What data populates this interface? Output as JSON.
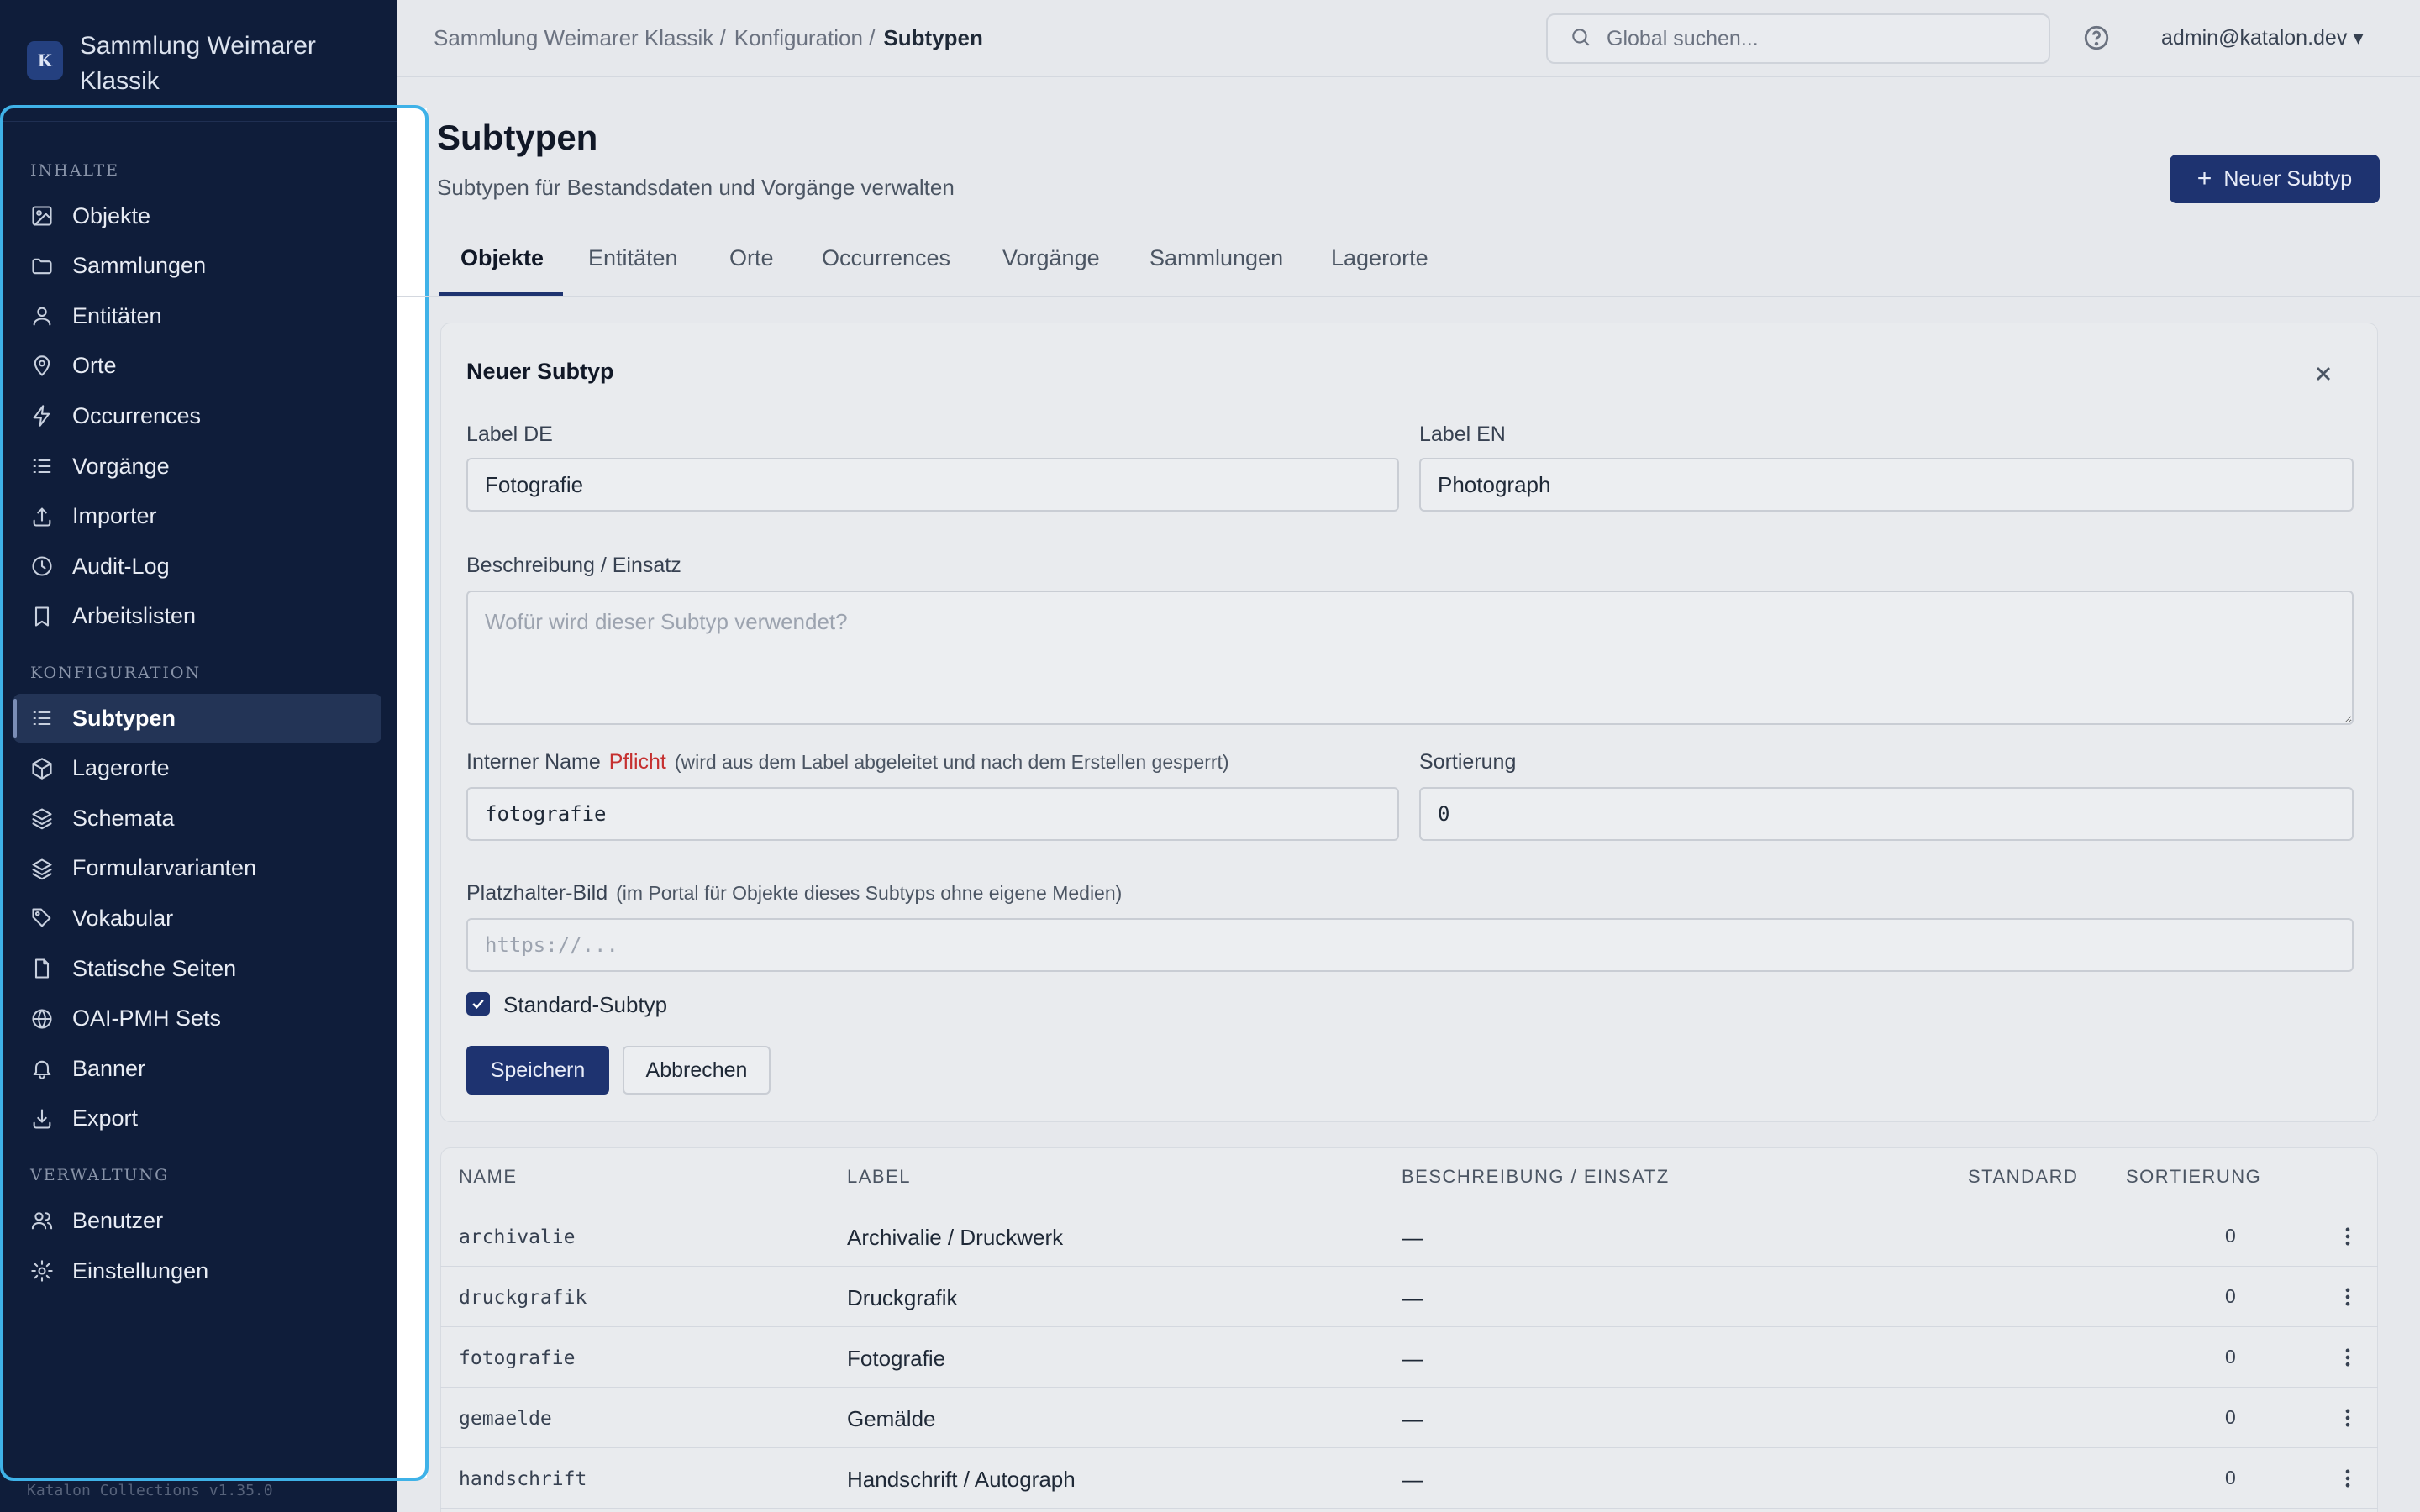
{
  "app": {
    "name": "Sammlung Weimarer Klassik",
    "logo_letter": "K",
    "version": "Katalon Collections v1.35.0"
  },
  "sidebar": {
    "groups": [
      {
        "title": "INHALTE",
        "items": [
          {
            "label": "Objekte",
            "icon": "image-icon"
          },
          {
            "label": "Sammlungen",
            "icon": "folder-icon"
          },
          {
            "label": "Entitäten",
            "icon": "user-icon"
          },
          {
            "label": "Orte",
            "icon": "map-pin-icon"
          },
          {
            "label": "Occurrences",
            "icon": "zap-icon"
          },
          {
            "label": "Vorgänge",
            "icon": "list-icon"
          },
          {
            "label": "Importer",
            "icon": "upload-icon"
          },
          {
            "label": "Audit-Log",
            "icon": "clock-icon"
          },
          {
            "label": "Arbeitslisten",
            "icon": "bookmark-icon"
          }
        ]
      },
      {
        "title": "KONFIGURATION",
        "items": [
          {
            "label": "Subtypen",
            "icon": "list-icon",
            "active": true
          },
          {
            "label": "Lagerorte",
            "icon": "box-icon"
          },
          {
            "label": "Schemata",
            "icon": "layers-icon"
          },
          {
            "label": "Formularvarianten",
            "icon": "layers-icon"
          },
          {
            "label": "Vokabular",
            "icon": "tag-icon"
          },
          {
            "label": "Statische Seiten",
            "icon": "file-icon"
          },
          {
            "label": "OAI-PMH Sets",
            "icon": "globe-icon"
          },
          {
            "label": "Banner",
            "icon": "bell-icon"
          },
          {
            "label": "Export",
            "icon": "download-icon"
          }
        ]
      },
      {
        "title": "VERWALTUNG",
        "items": [
          {
            "label": "Benutzer",
            "icon": "users-icon"
          },
          {
            "label": "Einstellungen",
            "icon": "gear-icon"
          }
        ]
      }
    ]
  },
  "topbar": {
    "breadcrumb": [
      "Sammlung Weimarer Klassik /",
      "Konfiguration /",
      "Subtypen"
    ],
    "search_placeholder": "Global suchen...",
    "user": "admin@katalon.dev ▾"
  },
  "page": {
    "title": "Subtypen",
    "subtitle": "Subtypen für Bestandsdaten und Vorgänge verwalten",
    "new_button": "Neuer Subtyp"
  },
  "tabs": [
    "Objekte",
    "Entitäten",
    "Orte",
    "Occurrences",
    "Vorgänge",
    "Sammlungen",
    "Lagerorte"
  ],
  "form": {
    "title": "Neuer Subtyp",
    "label_de": {
      "label": "Label DE",
      "value": "Fotografie"
    },
    "label_en": {
      "label": "Label EN",
      "value": "Photograph"
    },
    "description": {
      "label": "Beschreibung / Einsatz",
      "placeholder": "Wofür wird dieser Subtyp verwendet?"
    },
    "internal_name": {
      "label": "Interner Name",
      "required": "Pflicht",
      "hint": "(wird aus dem Label abgeleitet und nach dem Erstellen gesperrt)",
      "value": "fotografie"
    },
    "sort": {
      "label": "Sortierung",
      "value": "0"
    },
    "placeholder_image": {
      "label": "Platzhalter-Bild",
      "hint": "(im Portal für Objekte dieses Subtyps ohne eigene Medien)",
      "placeholder": "https://..."
    },
    "default_checkbox": {
      "label": "Standard-Subtyp",
      "checked": true
    },
    "save": "Speichern",
    "cancel": "Abbrechen"
  },
  "table": {
    "headers": [
      "NAME",
      "LABEL",
      "BESCHREIBUNG / EINSATZ",
      "STANDARD",
      "SORTIERUNG"
    ],
    "rows": [
      {
        "name": "archivalie",
        "label": "Archivalie / Druckwerk",
        "description": "—",
        "sort": "0"
      },
      {
        "name": "druckgrafik",
        "label": "Druckgrafik",
        "description": "—",
        "sort": "0"
      },
      {
        "name": "fotografie",
        "label": "Fotografie",
        "description": "—",
        "sort": "0"
      },
      {
        "name": "gemaelde",
        "label": "Gemälde",
        "description": "—",
        "sort": "0"
      },
      {
        "name": "handschrift",
        "label": "Handschrift / Autograph",
        "description": "—",
        "sort": "0"
      }
    ]
  },
  "colors": {
    "sidebar_bg": "#0f1d3a",
    "accent": "#1e3370",
    "focus_ring": "#3fb2e8",
    "required": "#c53030"
  }
}
